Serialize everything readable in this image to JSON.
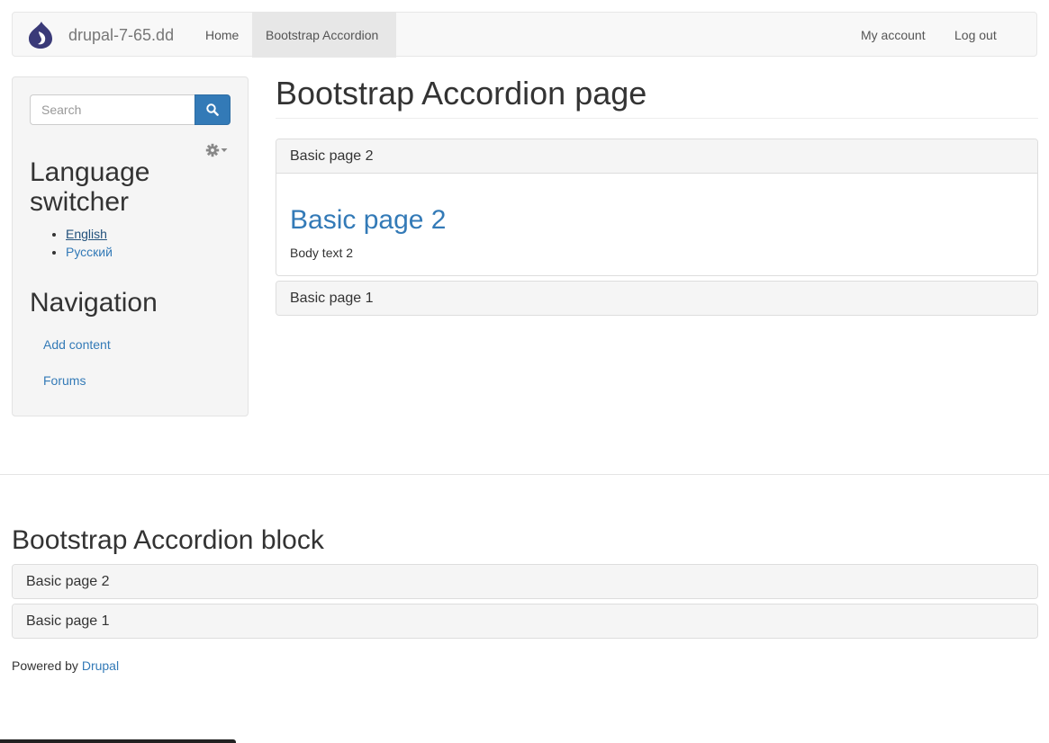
{
  "navbar": {
    "brand": "drupal-7-65.dd",
    "items": [
      {
        "label": "Home",
        "active": false
      },
      {
        "label": "Bootstrap Accordion",
        "active": true
      }
    ],
    "right_items": [
      {
        "label": "My account"
      },
      {
        "label": "Log out"
      }
    ]
  },
  "sidebar": {
    "search": {
      "placeholder": "Search"
    },
    "language_switcher": {
      "title": "Language switcher",
      "languages": [
        "English",
        "Русский"
      ]
    },
    "navigation": {
      "title": "Navigation",
      "links": [
        "Add content",
        "Forums"
      ]
    }
  },
  "main": {
    "title": "Bootstrap Accordion page",
    "accordion": [
      {
        "heading": "Basic page 2",
        "open": true,
        "body_title": "Basic page 2",
        "body_text": "Body text 2"
      },
      {
        "heading": "Basic page 1",
        "open": false
      }
    ]
  },
  "block": {
    "title": "Bootstrap Accordion block",
    "accordion": [
      {
        "heading": "Basic page 2"
      },
      {
        "heading": "Basic page 1"
      }
    ]
  },
  "footer": {
    "powered_prefix": "Powered by",
    "powered_link": "Drupal"
  },
  "colors": {
    "link": "#337ab7",
    "search_button": "#337ab7",
    "panel_heading_bg": "#f5f5f5",
    "drupal_logo": "#3a3a78"
  }
}
